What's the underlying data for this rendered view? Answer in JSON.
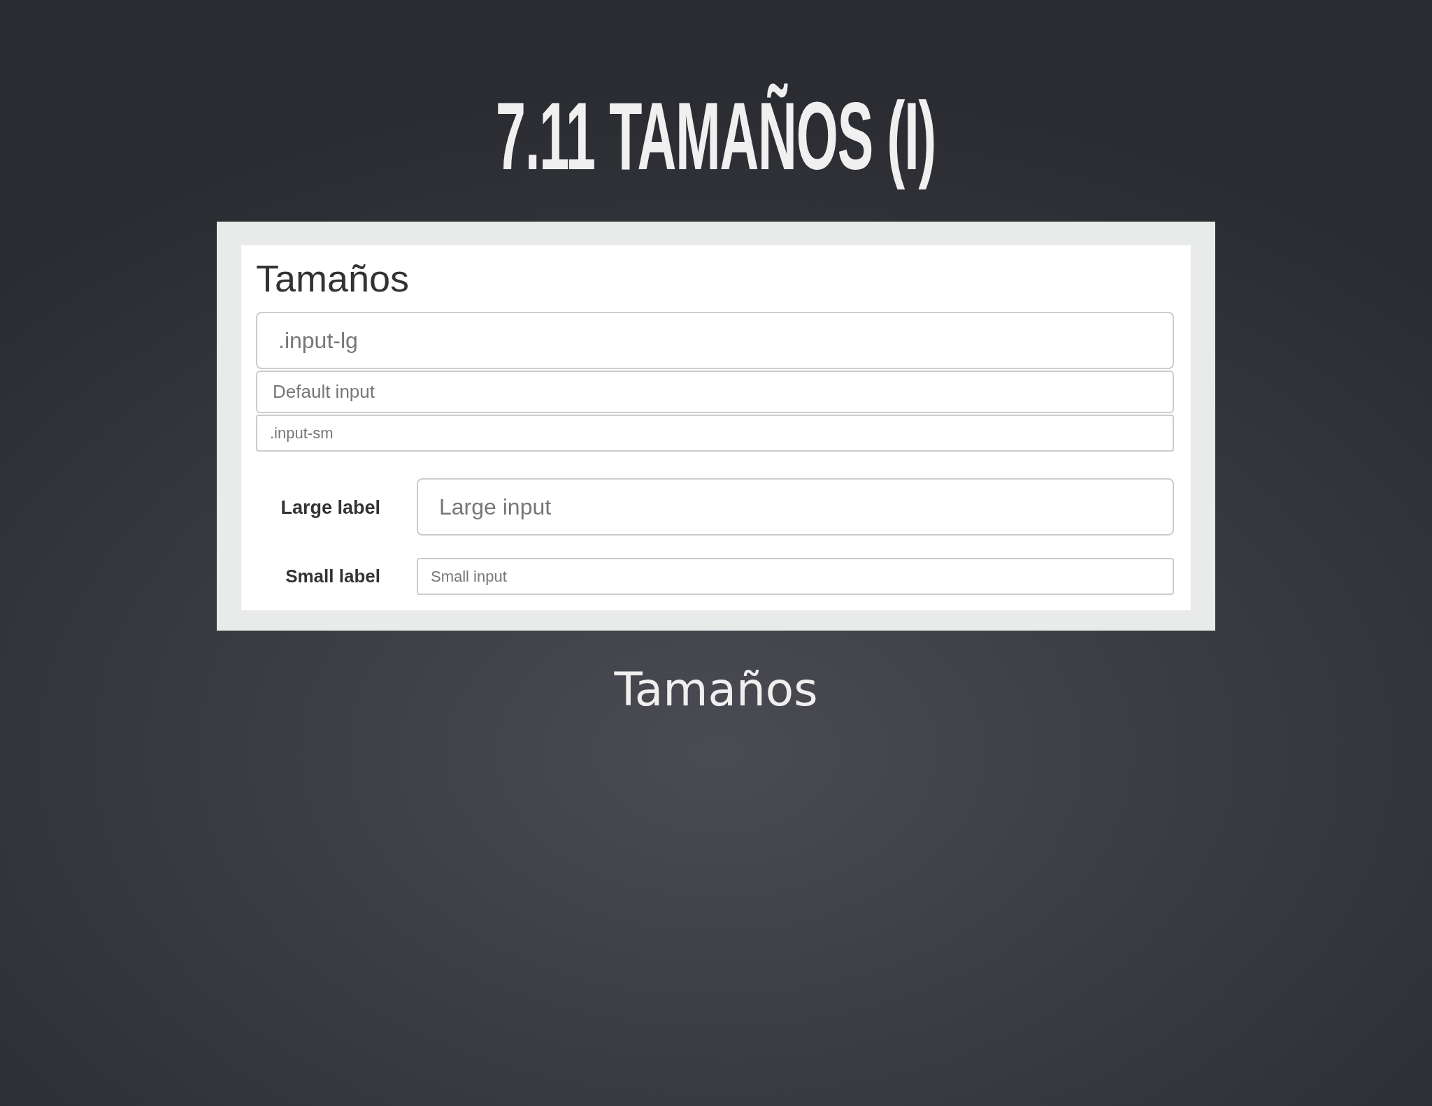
{
  "slide": {
    "title": "7.11 TAMAÑOS (I)",
    "caption": "Tamaños"
  },
  "screenshot": {
    "heading": "Tamaños",
    "inputs": [
      {
        "kind": "lg",
        "placeholder": ".input-lg"
      },
      {
        "kind": "default",
        "placeholder": "Default input"
      },
      {
        "kind": "sm",
        "placeholder": ".input-sm"
      }
    ],
    "form_rows": [
      {
        "kind": "lg",
        "label": "Large label",
        "placeholder": "Large input"
      },
      {
        "kind": "sm",
        "label": "Small label",
        "placeholder": "Small input"
      }
    ]
  }
}
